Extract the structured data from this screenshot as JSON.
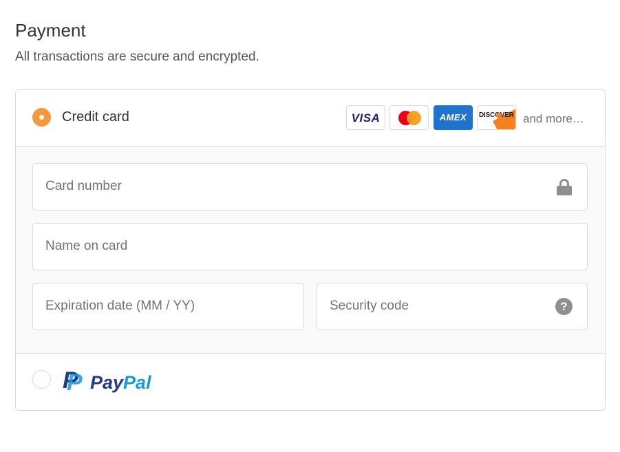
{
  "heading": {
    "title": "Payment",
    "subtitle": "All transactions are secure and encrypted."
  },
  "credit_card": {
    "label": "Credit card",
    "selected": true,
    "card_logos": [
      {
        "name": "visa",
        "text": "VISA"
      },
      {
        "name": "mastercard",
        "text": ""
      },
      {
        "name": "amex",
        "text": "AMEX"
      },
      {
        "name": "discover",
        "text": "DISCOVER"
      }
    ],
    "more_text": "and more…",
    "fields": {
      "card_number": {
        "placeholder": "Card number",
        "icon": "lock-icon"
      },
      "name_on_card": {
        "placeholder": "Name on card"
      },
      "expiration": {
        "placeholder": "Expiration date (MM / YY)"
      },
      "security_code": {
        "placeholder": "Security code",
        "icon": "help-icon",
        "icon_glyph": "?"
      }
    }
  },
  "paypal": {
    "selected": false,
    "logo_text_pay": "Pay",
    "logo_text_pal": "Pal",
    "logo_mark": "P"
  },
  "colors": {
    "accent": "#f6983c",
    "paypal_dark": "#253b80",
    "paypal_light": "#179bd7",
    "amex_blue": "#1f72cd"
  }
}
